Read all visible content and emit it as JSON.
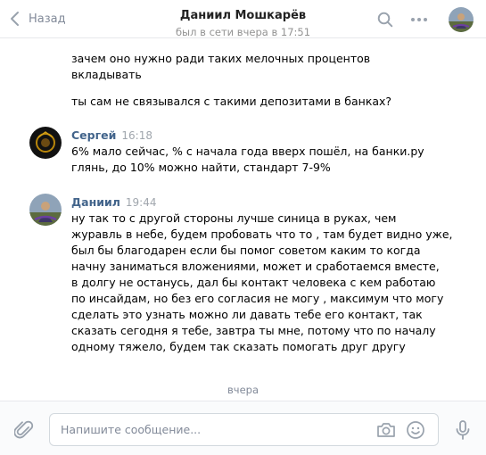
{
  "header": {
    "back_label": "Назад",
    "title": "Даниил Мошкарёв",
    "status": "был в сети вчера в 17:51",
    "icons": [
      "chevron-left-icon",
      "search-icon",
      "more-icon"
    ]
  },
  "messages": {
    "first_group": [
      "зачем оно нужно ради таких мелочных процентов",
      "вкладывать",
      "ты сам не связывался с такими депозитами в банках?"
    ],
    "sergey": {
      "author": "Сергей",
      "time": "16:18",
      "lines": [
        "6% мало сейчас, % с начала года вверх пошёл, на банки.ру",
        "глянь, до 10% можно найти, стандарт 7-9%"
      ]
    },
    "daniil": {
      "author": "Даниил",
      "time": "19:44",
      "lines": [
        "ну так то с другой стороны лучше синица в руках, чем",
        "журавль в небе, будем пробовать что то , там будет видно уже,",
        "был бы благодарен если бы помог советом каким то когда",
        "начну заниматься вложениями, может и сработаемся вместе,",
        "в долгу не останусь, дал бы контакт человека с кем работаю",
        "по инсайдам, но без его согласия не могу , максимум что могу",
        "сделать это узнать можно ли давать тебе его контакт, так",
        "сказать сегодня я тебе, завтра ты мне, потому что по началу",
        "одному тяжело, будем так сказать помогать друг другу"
      ]
    },
    "date_separator": "вчера"
  },
  "composer": {
    "placeholder": "Напишите сообщение...",
    "value": "",
    "icons": [
      "paperclip-icon",
      "camera-icon",
      "smile-icon",
      "microphone-icon"
    ]
  },
  "colors": {
    "accent": "#42648b",
    "muted": "#828a99",
    "icon": "#99a2ad",
    "border": "#e7e8ec"
  }
}
